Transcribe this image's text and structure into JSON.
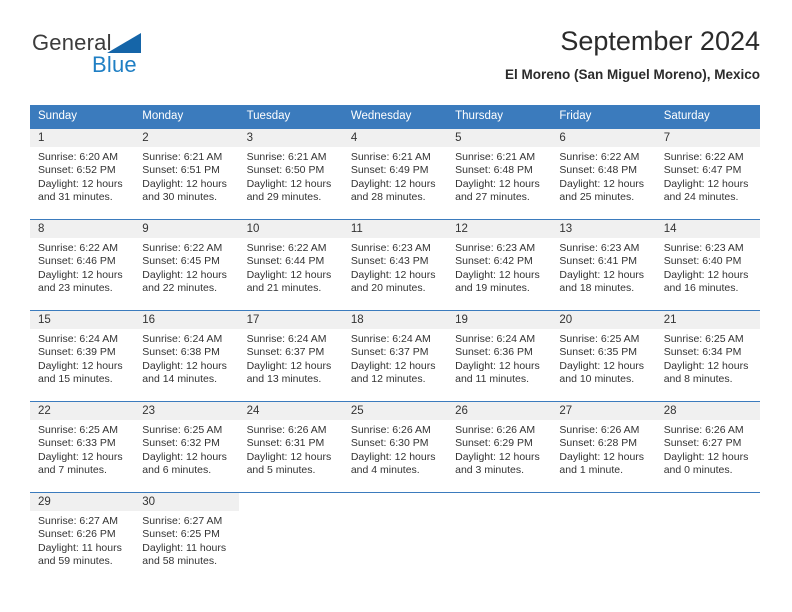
{
  "logo": {
    "word_top": "General",
    "word_bottom": "Blue",
    "triangle_color": "#1565a8",
    "blue_color": "#1f7fc4",
    "gray_color": "#3c3c3c"
  },
  "header": {
    "title": "September 2024",
    "subtitle": "El Moreno (San Miguel Moreno), Mexico"
  },
  "theme": {
    "header_blue": "#3b7bbd",
    "day_band_gray": "#f0f0f0",
    "text": "#333333"
  },
  "calendar": {
    "weekdays": [
      "Sunday",
      "Monday",
      "Tuesday",
      "Wednesday",
      "Thursday",
      "Friday",
      "Saturday"
    ],
    "weeks": [
      [
        {
          "day": "1",
          "sunrise": "Sunrise: 6:20 AM",
          "sunset": "Sunset: 6:52 PM",
          "daylight_line1": "Daylight: 12 hours",
          "daylight_line2": "and 31 minutes."
        },
        {
          "day": "2",
          "sunrise": "Sunrise: 6:21 AM",
          "sunset": "Sunset: 6:51 PM",
          "daylight_line1": "Daylight: 12 hours",
          "daylight_line2": "and 30 minutes."
        },
        {
          "day": "3",
          "sunrise": "Sunrise: 6:21 AM",
          "sunset": "Sunset: 6:50 PM",
          "daylight_line1": "Daylight: 12 hours",
          "daylight_line2": "and 29 minutes."
        },
        {
          "day": "4",
          "sunrise": "Sunrise: 6:21 AM",
          "sunset": "Sunset: 6:49 PM",
          "daylight_line1": "Daylight: 12 hours",
          "daylight_line2": "and 28 minutes."
        },
        {
          "day": "5",
          "sunrise": "Sunrise: 6:21 AM",
          "sunset": "Sunset: 6:48 PM",
          "daylight_line1": "Daylight: 12 hours",
          "daylight_line2": "and 27 minutes."
        },
        {
          "day": "6",
          "sunrise": "Sunrise: 6:22 AM",
          "sunset": "Sunset: 6:48 PM",
          "daylight_line1": "Daylight: 12 hours",
          "daylight_line2": "and 25 minutes."
        },
        {
          "day": "7",
          "sunrise": "Sunrise: 6:22 AM",
          "sunset": "Sunset: 6:47 PM",
          "daylight_line1": "Daylight: 12 hours",
          "daylight_line2": "and 24 minutes."
        }
      ],
      [
        {
          "day": "8",
          "sunrise": "Sunrise: 6:22 AM",
          "sunset": "Sunset: 6:46 PM",
          "daylight_line1": "Daylight: 12 hours",
          "daylight_line2": "and 23 minutes."
        },
        {
          "day": "9",
          "sunrise": "Sunrise: 6:22 AM",
          "sunset": "Sunset: 6:45 PM",
          "daylight_line1": "Daylight: 12 hours",
          "daylight_line2": "and 22 minutes."
        },
        {
          "day": "10",
          "sunrise": "Sunrise: 6:22 AM",
          "sunset": "Sunset: 6:44 PM",
          "daylight_line1": "Daylight: 12 hours",
          "daylight_line2": "and 21 minutes."
        },
        {
          "day": "11",
          "sunrise": "Sunrise: 6:23 AM",
          "sunset": "Sunset: 6:43 PM",
          "daylight_line1": "Daylight: 12 hours",
          "daylight_line2": "and 20 minutes."
        },
        {
          "day": "12",
          "sunrise": "Sunrise: 6:23 AM",
          "sunset": "Sunset: 6:42 PM",
          "daylight_line1": "Daylight: 12 hours",
          "daylight_line2": "and 19 minutes."
        },
        {
          "day": "13",
          "sunrise": "Sunrise: 6:23 AM",
          "sunset": "Sunset: 6:41 PM",
          "daylight_line1": "Daylight: 12 hours",
          "daylight_line2": "and 18 minutes."
        },
        {
          "day": "14",
          "sunrise": "Sunrise: 6:23 AM",
          "sunset": "Sunset: 6:40 PM",
          "daylight_line1": "Daylight: 12 hours",
          "daylight_line2": "and 16 minutes."
        }
      ],
      [
        {
          "day": "15",
          "sunrise": "Sunrise: 6:24 AM",
          "sunset": "Sunset: 6:39 PM",
          "daylight_line1": "Daylight: 12 hours",
          "daylight_line2": "and 15 minutes."
        },
        {
          "day": "16",
          "sunrise": "Sunrise: 6:24 AM",
          "sunset": "Sunset: 6:38 PM",
          "daylight_line1": "Daylight: 12 hours",
          "daylight_line2": "and 14 minutes."
        },
        {
          "day": "17",
          "sunrise": "Sunrise: 6:24 AM",
          "sunset": "Sunset: 6:37 PM",
          "daylight_line1": "Daylight: 12 hours",
          "daylight_line2": "and 13 minutes."
        },
        {
          "day": "18",
          "sunrise": "Sunrise: 6:24 AM",
          "sunset": "Sunset: 6:37 PM",
          "daylight_line1": "Daylight: 12 hours",
          "daylight_line2": "and 12 minutes."
        },
        {
          "day": "19",
          "sunrise": "Sunrise: 6:24 AM",
          "sunset": "Sunset: 6:36 PM",
          "daylight_line1": "Daylight: 12 hours",
          "daylight_line2": "and 11 minutes."
        },
        {
          "day": "20",
          "sunrise": "Sunrise: 6:25 AM",
          "sunset": "Sunset: 6:35 PM",
          "daylight_line1": "Daylight: 12 hours",
          "daylight_line2": "and 10 minutes."
        },
        {
          "day": "21",
          "sunrise": "Sunrise: 6:25 AM",
          "sunset": "Sunset: 6:34 PM",
          "daylight_line1": "Daylight: 12 hours",
          "daylight_line2": "and 8 minutes."
        }
      ],
      [
        {
          "day": "22",
          "sunrise": "Sunrise: 6:25 AM",
          "sunset": "Sunset: 6:33 PM",
          "daylight_line1": "Daylight: 12 hours",
          "daylight_line2": "and 7 minutes."
        },
        {
          "day": "23",
          "sunrise": "Sunrise: 6:25 AM",
          "sunset": "Sunset: 6:32 PM",
          "daylight_line1": "Daylight: 12 hours",
          "daylight_line2": "and 6 minutes."
        },
        {
          "day": "24",
          "sunrise": "Sunrise: 6:26 AM",
          "sunset": "Sunset: 6:31 PM",
          "daylight_line1": "Daylight: 12 hours",
          "daylight_line2": "and 5 minutes."
        },
        {
          "day": "25",
          "sunrise": "Sunrise: 6:26 AM",
          "sunset": "Sunset: 6:30 PM",
          "daylight_line1": "Daylight: 12 hours",
          "daylight_line2": "and 4 minutes."
        },
        {
          "day": "26",
          "sunrise": "Sunrise: 6:26 AM",
          "sunset": "Sunset: 6:29 PM",
          "daylight_line1": "Daylight: 12 hours",
          "daylight_line2": "and 3 minutes."
        },
        {
          "day": "27",
          "sunrise": "Sunrise: 6:26 AM",
          "sunset": "Sunset: 6:28 PM",
          "daylight_line1": "Daylight: 12 hours",
          "daylight_line2": "and 1 minute."
        },
        {
          "day": "28",
          "sunrise": "Sunrise: 6:26 AM",
          "sunset": "Sunset: 6:27 PM",
          "daylight_line1": "Daylight: 12 hours",
          "daylight_line2": "and 0 minutes."
        }
      ],
      [
        {
          "day": "29",
          "sunrise": "Sunrise: 6:27 AM",
          "sunset": "Sunset: 6:26 PM",
          "daylight_line1": "Daylight: 11 hours",
          "daylight_line2": "and 59 minutes."
        },
        {
          "day": "30",
          "sunrise": "Sunrise: 6:27 AM",
          "sunset": "Sunset: 6:25 PM",
          "daylight_line1": "Daylight: 11 hours",
          "daylight_line2": "and 58 minutes."
        },
        {
          "day": "",
          "sunrise": "",
          "sunset": "",
          "daylight_line1": "",
          "daylight_line2": ""
        },
        {
          "day": "",
          "sunrise": "",
          "sunset": "",
          "daylight_line1": "",
          "daylight_line2": ""
        },
        {
          "day": "",
          "sunrise": "",
          "sunset": "",
          "daylight_line1": "",
          "daylight_line2": ""
        },
        {
          "day": "",
          "sunrise": "",
          "sunset": "",
          "daylight_line1": "",
          "daylight_line2": ""
        },
        {
          "day": "",
          "sunrise": "",
          "sunset": "",
          "daylight_line1": "",
          "daylight_line2": ""
        }
      ]
    ]
  }
}
